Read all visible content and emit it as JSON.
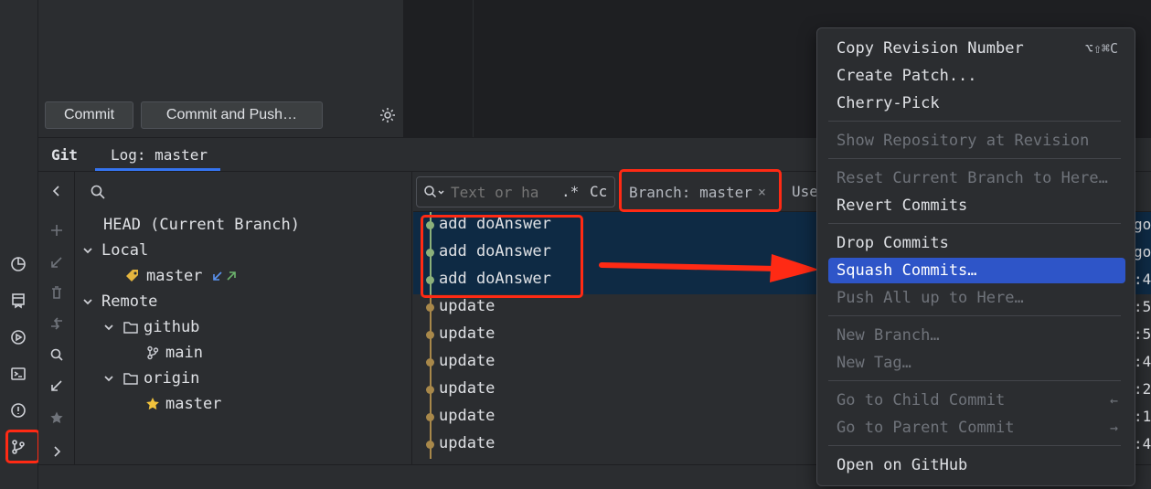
{
  "toolbar": {
    "commit_label": "Commit",
    "commit_push_label": "Commit and Push…"
  },
  "tool_window": {
    "title": "Git",
    "tab": "Log: master"
  },
  "branches": {
    "head": "HEAD (Current Branch)",
    "local_label": "Local",
    "local_branch": "master",
    "remote_label": "Remote",
    "remote1": "github",
    "remote1_branch": "main",
    "remote2": "origin",
    "remote2_branch": "master"
  },
  "filter": {
    "search_placeholder": "Text or ha",
    "regex_label": ".*",
    "case_label": "Cc",
    "branch_filter": "Branch: master",
    "user_filter_partial": "Use"
  },
  "commits": [
    {
      "msg": "add doAnswer",
      "selected": true
    },
    {
      "msg": "add doAnswer",
      "selected": true
    },
    {
      "msg": "add doAnswer",
      "selected": true
    },
    {
      "msg": "update",
      "selected": false
    },
    {
      "msg": "update",
      "selected": false
    },
    {
      "msg": "update",
      "selected": false
    },
    {
      "msg": "update",
      "selected": false
    },
    {
      "msg": "update",
      "selected": false
    },
    {
      "msg": "update",
      "selected": false
    }
  ],
  "right_edge_fragments": [
    "go",
    "go",
    ":4",
    ":5",
    ":5",
    ":4",
    ":2",
    ":1",
    ":4"
  ],
  "context_menu": {
    "items": [
      {
        "label": "Copy Revision Number",
        "shortcut": "⌥⇧⌘C",
        "state": "enabled"
      },
      {
        "label": "Create Patch...",
        "state": "enabled"
      },
      {
        "label": "Cherry-Pick",
        "state": "enabled"
      },
      {
        "label": "Show Repository at Revision",
        "state": "disabled"
      },
      {
        "label": "Reset Current Branch to Here…",
        "state": "disabled"
      },
      {
        "label": "Revert Commits",
        "state": "enabled"
      },
      {
        "label": "Drop Commits",
        "state": "enabled"
      },
      {
        "label": "Squash Commits…",
        "state": "active"
      },
      {
        "label": "Push All up to Here…",
        "state": "disabled"
      },
      {
        "label": "New Branch…",
        "state": "disabled"
      },
      {
        "label": "New Tag…",
        "state": "disabled"
      },
      {
        "label": "Go to Child Commit",
        "shortcut": "←",
        "state": "disabled"
      },
      {
        "label": "Go to Parent Commit",
        "shortcut": "→",
        "state": "disabled"
      },
      {
        "label": "Open on GitHub",
        "state": "enabled"
      }
    ]
  },
  "colors": {
    "annotation_red": "#ff2a14",
    "menu_highlight": "#2e55c8",
    "selection_bg": "#0e2a44",
    "graph_green": "#8bb07a",
    "graph_brown": "#a8884a"
  }
}
